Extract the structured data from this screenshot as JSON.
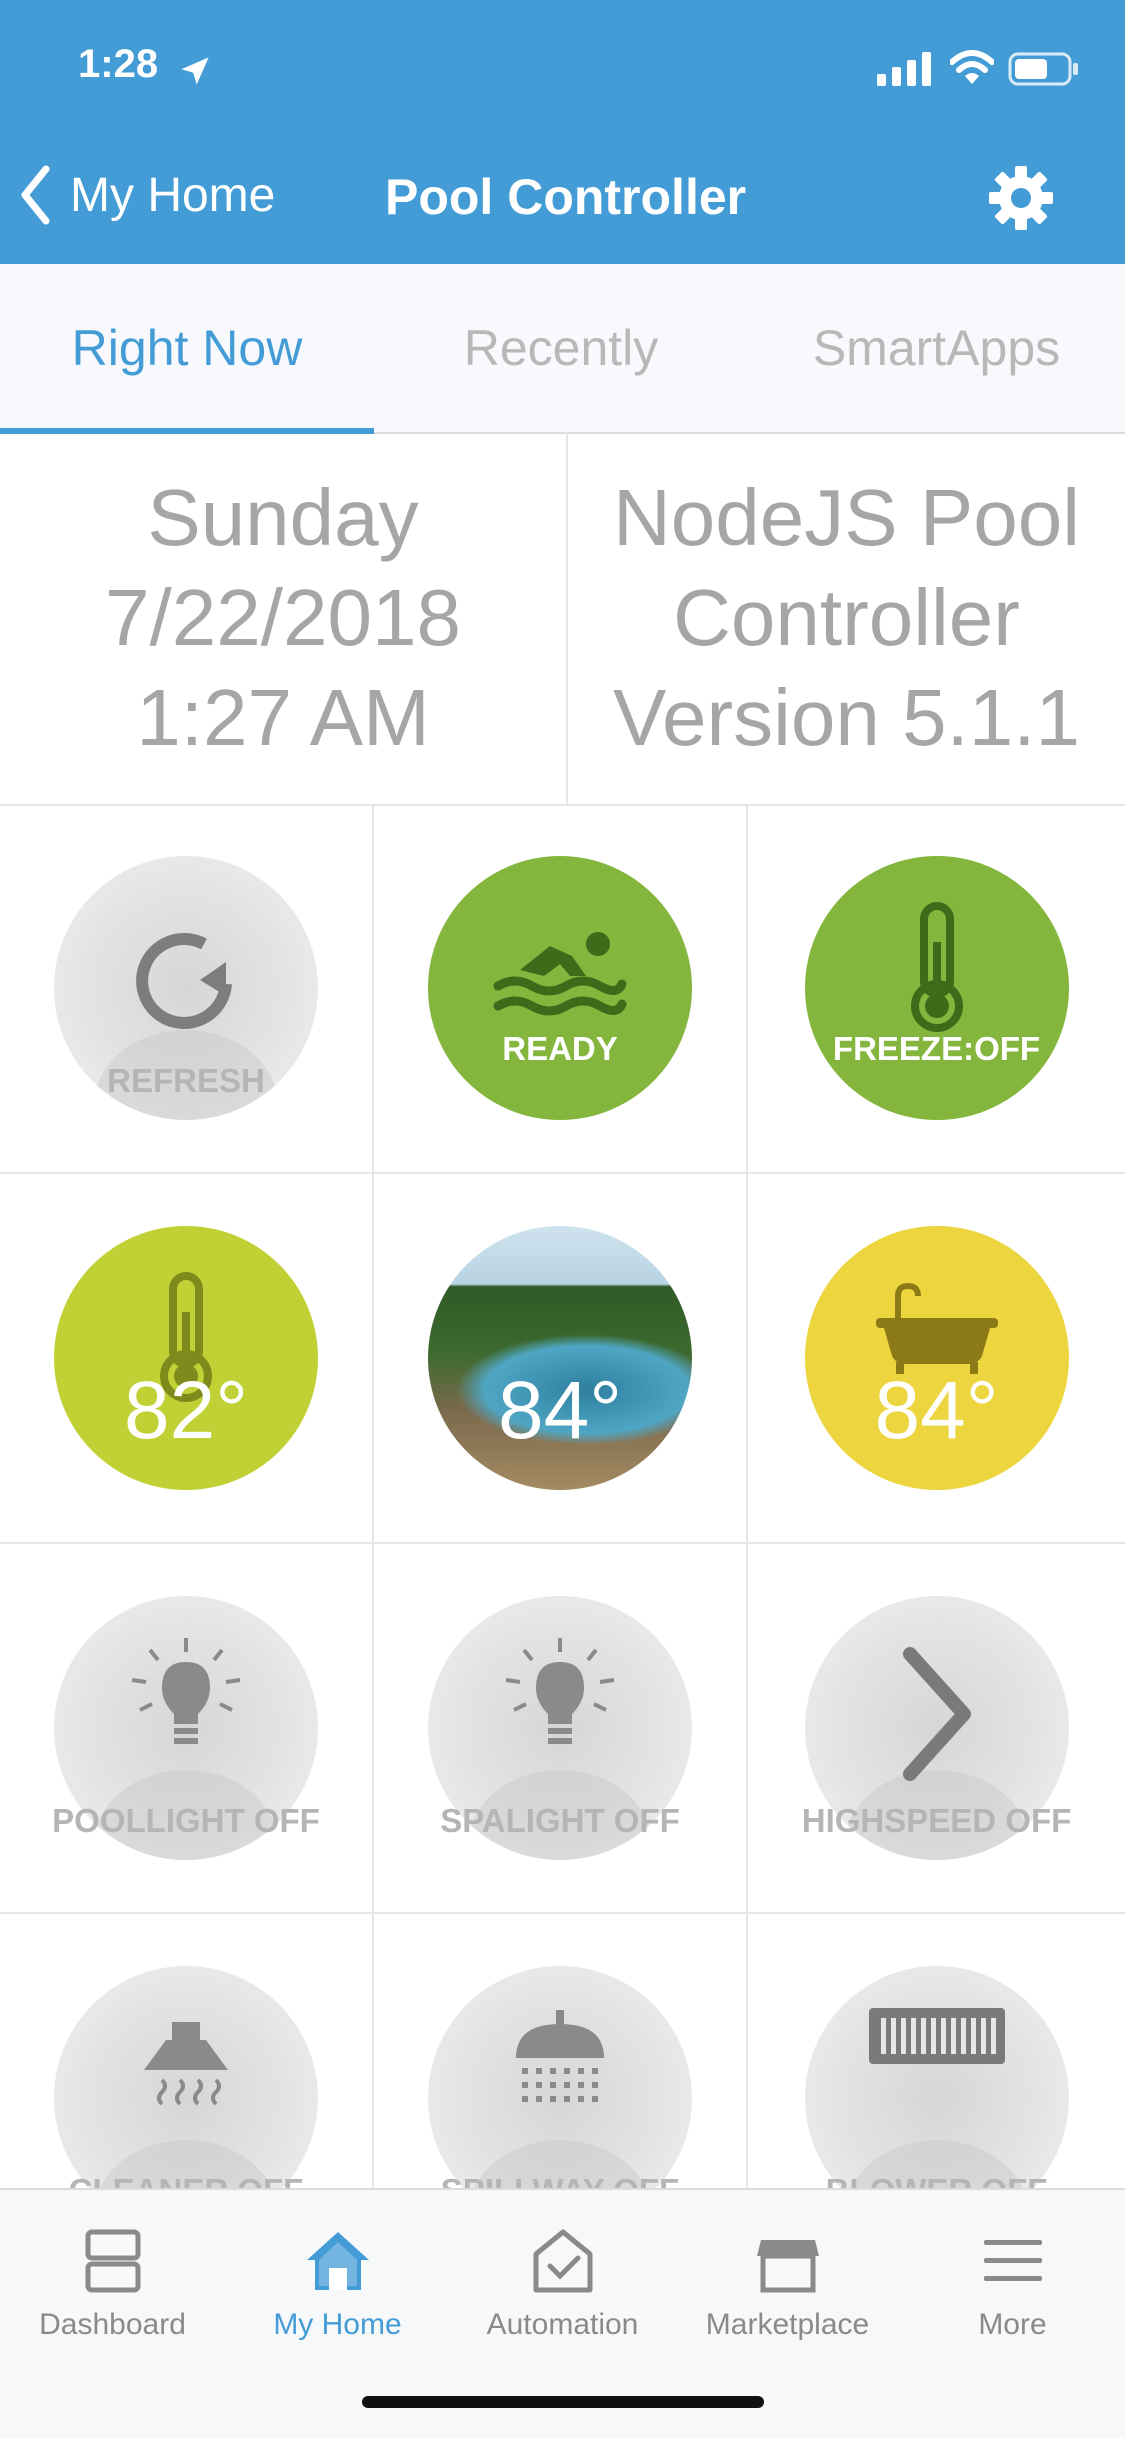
{
  "status_bar": {
    "time": "1:28"
  },
  "nav": {
    "back_label": "My Home",
    "title": "Pool Controller"
  },
  "tabs": [
    {
      "label": "Right Now",
      "active": true
    },
    {
      "label": "Recently",
      "active": false
    },
    {
      "label": "SmartApps",
      "active": false
    }
  ],
  "info": {
    "date_lines": [
      "Sunday",
      "7/22/2018",
      "1:27 AM"
    ],
    "version_lines": [
      "NodeJS Pool",
      "Controller",
      "Version 5.1.1"
    ]
  },
  "tiles": [
    {
      "label": "REFRESH",
      "icon": "refresh-icon",
      "style": "gray"
    },
    {
      "label": "READY",
      "icon": "swimmer-icon",
      "style": "green",
      "color": "#84b63d"
    },
    {
      "label": "FREEZE:OFF",
      "icon": "thermometer-icon",
      "style": "green",
      "color": "#84b63d"
    },
    {
      "label": "82°",
      "icon": "thermometer-icon",
      "style": "lime",
      "color": "#c1d135"
    },
    {
      "label": "84°",
      "icon": "pool-photo",
      "style": "photo"
    },
    {
      "label": "84°",
      "icon": "bathtub-icon",
      "style": "yellow",
      "color": "#ecd53f"
    },
    {
      "label": "POOLLIGHT OFF",
      "icon": "lightbulb-icon",
      "style": "gray"
    },
    {
      "label": "SPALIGHT OFF",
      "icon": "lightbulb-icon",
      "style": "gray"
    },
    {
      "label": "HIGHSPEED OFF",
      "icon": "chevron-right-icon",
      "style": "gray"
    },
    {
      "label": "CLEANER OFF",
      "icon": "cleaner-icon",
      "style": "gray"
    },
    {
      "label": "SPILLWAY OFF",
      "icon": "shower-icon",
      "style": "gray"
    },
    {
      "label": "BLOWER OFF",
      "icon": "vent-icon",
      "style": "gray"
    }
  ],
  "tabbar": [
    {
      "label": "Dashboard",
      "icon": "dashboard-icon",
      "active": false
    },
    {
      "label": "My Home",
      "icon": "home-icon",
      "active": true
    },
    {
      "label": "Automation",
      "icon": "automation-icon",
      "active": false
    },
    {
      "label": "Marketplace",
      "icon": "marketplace-icon",
      "active": false
    },
    {
      "label": "More",
      "icon": "menu-icon",
      "active": false
    }
  ],
  "colors": {
    "accent": "#449cd6",
    "gray_text": "#a6a6a6"
  }
}
